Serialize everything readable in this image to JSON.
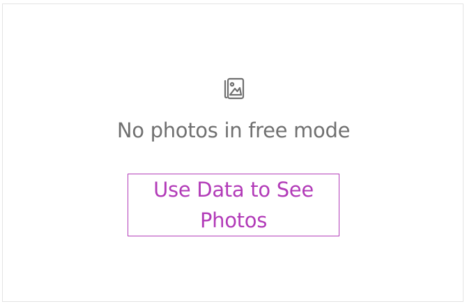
{
  "empty_state": {
    "icon": "photo-stack-icon",
    "message": "No photos in free mode",
    "cta_label": "Use Data to See Photos"
  },
  "colors": {
    "message_text": "#707070",
    "accent": "#b23bb8",
    "border": "#e3e3e3"
  }
}
